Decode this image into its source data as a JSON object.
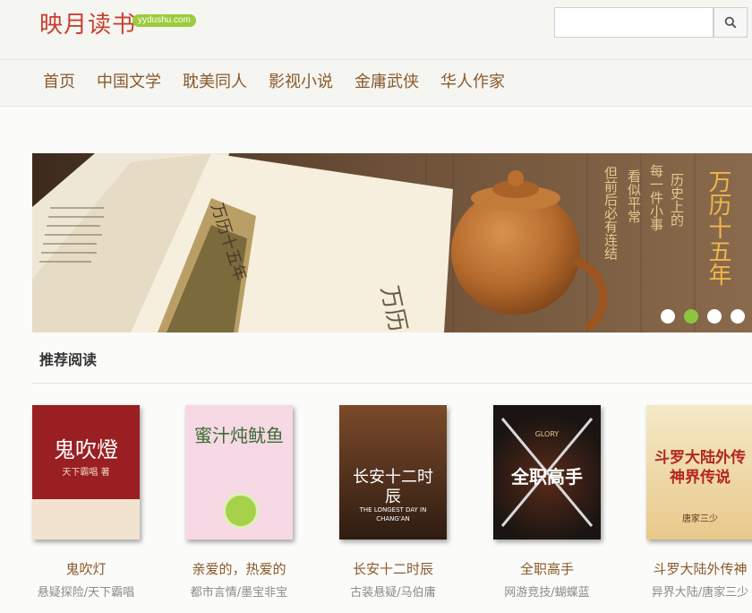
{
  "site": {
    "logo": "映月读书",
    "logo_badge": "yydushu.com"
  },
  "search": {
    "placeholder": "",
    "value": "",
    "icon": "search-icon"
  },
  "nav": [
    {
      "label": "首页"
    },
    {
      "label": "中国文学"
    },
    {
      "label": "耽美同人"
    },
    {
      "label": "影视小说"
    },
    {
      "label": "金庸武侠"
    },
    {
      "label": "华人作家"
    }
  ],
  "banner": {
    "book_title": "万历十五年",
    "verse_lines": [
      "历史上的",
      "每一件小事",
      "看似平常",
      "但前后必有连结"
    ],
    "book_spine": "万历十五年",
    "dots": [
      false,
      true,
      false,
      false
    ]
  },
  "recommend": {
    "heading": "推荐阅读",
    "books": [
      {
        "title": "鬼吹灯",
        "meta": "悬疑探险/天下霸唱",
        "cover_title": "鬼吹燈",
        "cover_author": "天下霸唱 著",
        "cover_color": "#9a1f22"
      },
      {
        "title": "亲爱的，热爱的",
        "meta": "都市言情/墨宝非宝",
        "cover_title": "蜜汁炖鱿鱼",
        "cover_color": "#f6d9e6"
      },
      {
        "title": "长安十二时辰",
        "meta": "古装悬疑/马伯庸",
        "cover_title": "长安十二时辰",
        "cover_sub": "THE LONGEST DAY IN CHANG'AN",
        "cover_color": "#3a2518"
      },
      {
        "title": "全职高手",
        "meta": "网游竞技/蝴蝶蓝",
        "cover_title": "全职高手",
        "cover_badge": "GLORY",
        "cover_color": "#1e1a16"
      },
      {
        "title": "斗罗大陆外传神",
        "meta": "异界大陆/唐家三少",
        "cover_title": "斗罗大陆外传 神界传说",
        "cover_author": "唐家三少",
        "cover_color": "#f1e6c6"
      }
    ]
  },
  "colors": {
    "accent": "#8cc63e",
    "nav_text": "#8a5a2b",
    "logo": "#c8402f"
  }
}
